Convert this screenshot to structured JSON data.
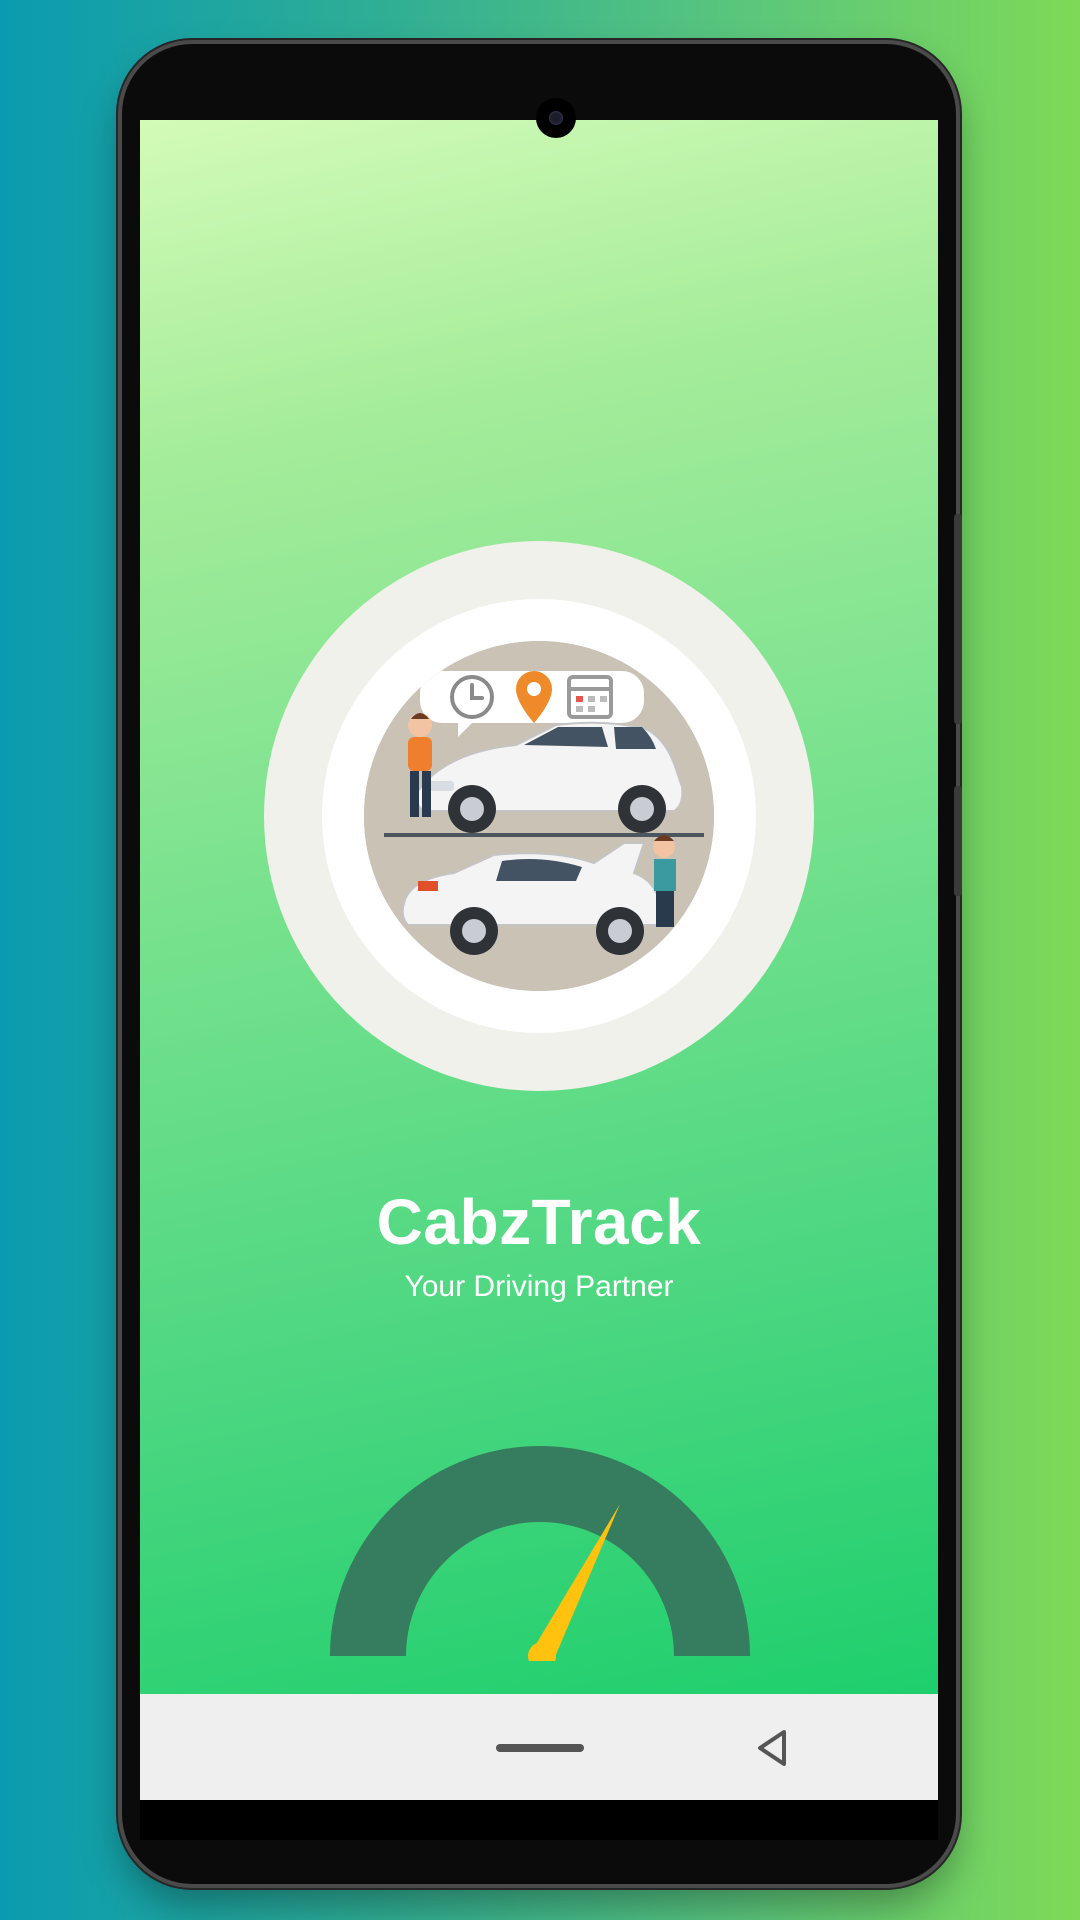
{
  "app": {
    "title": "CabzTrack",
    "tagline": "Your Driving Partner"
  },
  "gauge": {
    "level": 0.6
  },
  "colors": {
    "gradient_top": "#d3fbb8",
    "gradient_bottom": "#1ecf6c",
    "gauge_arc": "#357d5e",
    "gauge_needle": "#ffc20e",
    "nav_bar": "#efefef"
  },
  "navigation": {
    "home_icon": "home-pill-icon",
    "back_icon": "back-triangle-icon"
  }
}
